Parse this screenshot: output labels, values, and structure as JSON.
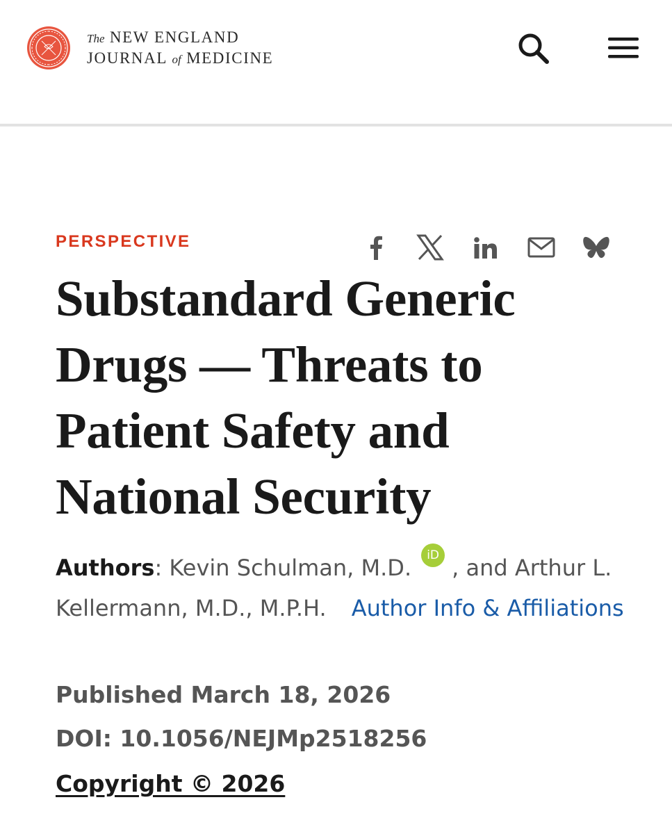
{
  "header": {
    "logo": {
      "line1_prefix": "The",
      "line1_main": "NEW ENGLAND",
      "line2_part1": "JOURNAL",
      "line2_of": "of",
      "line2_part2": "MEDICINE",
      "seal_color": "#e8553f"
    },
    "search_icon": "search-icon",
    "menu_icon": "hamburger-menu-icon"
  },
  "article": {
    "kicker": "PERSPECTIVE",
    "kicker_color": "#d9381e",
    "share_icons": [
      "facebook-icon",
      "x-icon",
      "linkedin-icon",
      "email-icon",
      "bluesky-icon"
    ],
    "title": "Substandard Generic Drugs — Threats to Patient Safety and National Security",
    "authors": {
      "label": "Authors",
      "separator": ": ",
      "author1": "Kevin Schulman, M.D.",
      "orcid_badge": "iD",
      "orcid_color": "#a6ce39",
      "conjunction": ", and Arthur L. Kellermann, M.D., M.P.H.",
      "info_link": "Author Info & Affiliations",
      "link_color": "#1a5ca8"
    },
    "published": "Published March 18, 2026",
    "doi": "DOI: 10.1056/NEJMp2518256",
    "copyright": "Copyright © 2026"
  }
}
